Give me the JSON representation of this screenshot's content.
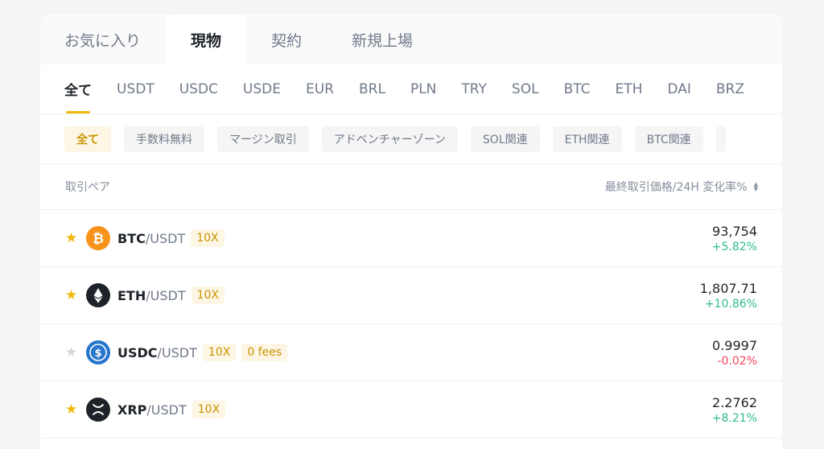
{
  "top_tabs": [
    {
      "label": "お気に入り"
    },
    {
      "label": "現物"
    },
    {
      "label": "契約"
    },
    {
      "label": "新規上場"
    }
  ],
  "quote_tabs": [
    {
      "label": "全て"
    },
    {
      "label": "USDT"
    },
    {
      "label": "USDC"
    },
    {
      "label": "USDE"
    },
    {
      "label": "EUR"
    },
    {
      "label": "BRL"
    },
    {
      "label": "PLN"
    },
    {
      "label": "TRY"
    },
    {
      "label": "SOL"
    },
    {
      "label": "BTC"
    },
    {
      "label": "ETH"
    },
    {
      "label": "DAI"
    },
    {
      "label": "BRZ"
    }
  ],
  "filters": [
    {
      "label": "全て"
    },
    {
      "label": "手数料無料"
    },
    {
      "label": "マージン取引"
    },
    {
      "label": "アドベンチャーゾーン"
    },
    {
      "label": "SOL関連"
    },
    {
      "label": "ETH関連"
    },
    {
      "label": "BTC関連"
    }
  ],
  "table": {
    "pair_header": "取引ペア",
    "price_header": "最終取引価格/24H 変化率%"
  },
  "rows": [
    {
      "base": "BTC",
      "quote": "/USDT",
      "leverage": "10X",
      "price": "93,754",
      "change": "+5.82%",
      "favorite": true,
      "icon": "bitcoin-icon"
    },
    {
      "base": "ETH",
      "quote": "/USDT",
      "leverage": "10X",
      "price": "1,807.71",
      "change": "+10.86%",
      "favorite": true,
      "icon": "ethereum-icon"
    },
    {
      "base": "USDC",
      "quote": "/USDT",
      "leverage": "10X",
      "fees": "0 fees",
      "price": "0.9997",
      "change": "-0.02%",
      "favorite": false,
      "icon": "usdc-icon"
    },
    {
      "base": "XRP",
      "quote": "/USDT",
      "leverage": "10X",
      "price": "2.2762",
      "change": "+8.21%",
      "favorite": true,
      "icon": "xrp-icon"
    }
  ],
  "colors": {
    "accent": "#f0b90b",
    "up": "#2ebd85",
    "down": "#f6465d",
    "btc": "#f7931a",
    "eth": "#1e2329",
    "usdc": "#2775ca",
    "xrp": "#1e2329"
  }
}
